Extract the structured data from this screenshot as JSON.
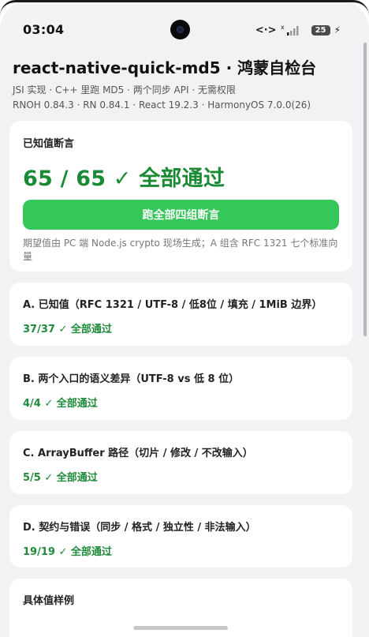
{
  "status_bar": {
    "time": "03:04",
    "network_glyph": "<·>",
    "signal_label": "x",
    "battery_level": "25",
    "charging_glyph": "⚡"
  },
  "header": {
    "title": "react-native-quick-md5 · 鸿蒙自检台",
    "subtitle": "JSI 实现 · C++ 里跑 MD5 · 两个同步 API · 无需权限",
    "meta": "RNOH 0.84.3 · RN 0.84.1 · React 19.2.3 · HarmonyOS 7.0.0(26)"
  },
  "known_values_card": {
    "heading": "已知值断言",
    "result": "65 / 65 ✓ 全部通过",
    "run_button_label": "跑全部四组断言",
    "footnote": "期望值由 PC 端 Node.js crypto 现场生成；A 组含 RFC 1321 七个标准向量"
  },
  "groups": [
    {
      "heading": "A. 已知值（RFC 1321 / UTF-8 / 低8位 / 填充 / 1MiB 边界）",
      "summary": "37/37 ✓ 全部通过"
    },
    {
      "heading": "B. 两个入口的语义差异（UTF-8 vs 低 8 位）",
      "summary": "4/4 ✓ 全部通过"
    },
    {
      "heading": "C. ArrayBuffer 路径（切片 / 修改 / 不改输入）",
      "summary": "5/5 ✓ 全部通过"
    },
    {
      "heading": "D. 契约与错误（同步 / 格式 / 独立性 / 非法输入）",
      "summary": "19/19 ✓ 全部通过"
    }
  ],
  "samples_card": {
    "heading": "具体值样例"
  },
  "colors": {
    "pass_green": "#1f8a3a",
    "button_green": "#35c759",
    "background": "#f2f2f4",
    "card": "#ffffff"
  }
}
